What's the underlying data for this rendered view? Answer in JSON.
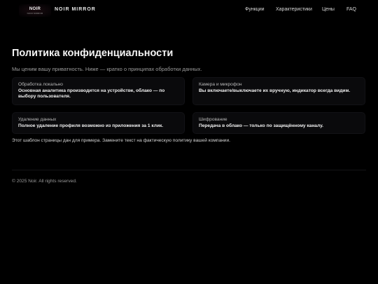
{
  "brand": {
    "logo_word": "NOIR",
    "logo_sub": "NOIR MIRROR",
    "name": "NOIR MIRROR"
  },
  "nav": {
    "items": [
      {
        "label": "Функции"
      },
      {
        "label": "Характеристики"
      },
      {
        "label": "Цены"
      },
      {
        "label": "FAQ"
      }
    ]
  },
  "main": {
    "title": "Политика конфиденциальности",
    "subtitle": "Мы ценим вашу приватность. Ниже — кратко о принципах обработки данных.",
    "cards": [
      {
        "label": "Обработка локально",
        "text": "Основная аналитика производится на устройстве, облако — по выбору пользователя."
      },
      {
        "label": "Камера и микрофон",
        "text": "Вы включаете/выключаете их вручную, индикатор всегда видим."
      },
      {
        "label": "Удаление данных",
        "text": "Полное удаление профиля возможно из приложения за 1 клик."
      },
      {
        "label": "Шифрование",
        "text": "Передача в облако — только по защищённому каналу."
      }
    ],
    "note": "Этот шаблон страницы дан для примера. Замените текст на фактическую политику вашей компании."
  },
  "footer": {
    "copyright": "© 2025 Noir. All rights reserved."
  },
  "colors": {
    "background": "#000000",
    "card_background": "#0a0a0c",
    "text_primary": "#f0f0f0",
    "text_muted": "#9c9c9c"
  }
}
